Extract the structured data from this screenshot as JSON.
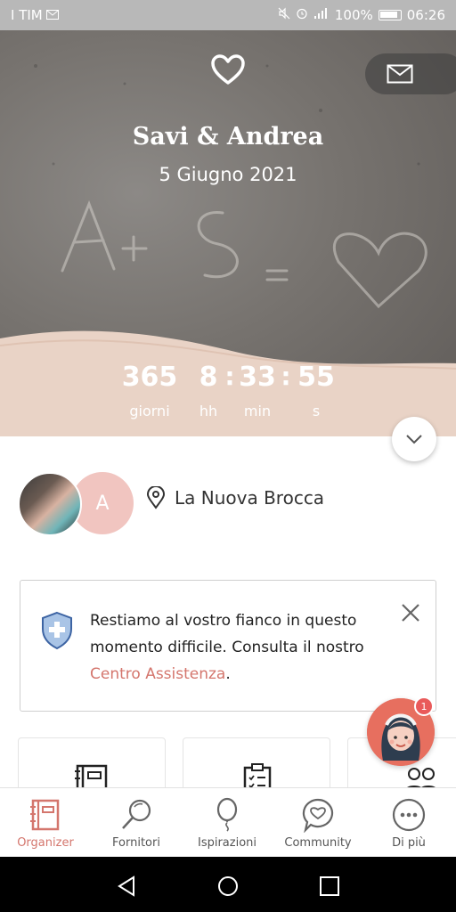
{
  "status_bar": {
    "carrier": "I TIM",
    "battery": "100%",
    "time": "06:26"
  },
  "hero": {
    "couple_names": "Savi & Andrea",
    "wedding_date": "5 Giugno 2021",
    "countdown": {
      "days": "365",
      "days_label": "giorni",
      "hours": "8",
      "hours_label": "hh",
      "minutes": "33",
      "minutes_label": "min",
      "seconds": "55",
      "seconds_label": "s",
      "separator": ":"
    }
  },
  "profile": {
    "partner_initial": "A",
    "venue": "La Nuova Brocca"
  },
  "notice": {
    "text": "Restiamo al vostro fianco in questo momento difficile. Consulta il nostro",
    "link_text": "Centro Assistenza",
    "suffix": "."
  },
  "assistant": {
    "badge_count": "1"
  },
  "bottom_nav": {
    "items": [
      {
        "label": "Organizer",
        "icon": "organizer-icon",
        "active": true
      },
      {
        "label": "Fornitori",
        "icon": "search-icon",
        "active": false
      },
      {
        "label": "Ispirazioni",
        "icon": "balloon-icon",
        "active": false
      },
      {
        "label": "Community",
        "icon": "chat-heart-icon",
        "active": false
      },
      {
        "label": "Di più",
        "icon": "more-icon",
        "active": false
      }
    ]
  },
  "colors": {
    "accent": "#d4766d",
    "sand_band": "#e9d3c6",
    "avatar_pink": "#f1c5c0"
  }
}
